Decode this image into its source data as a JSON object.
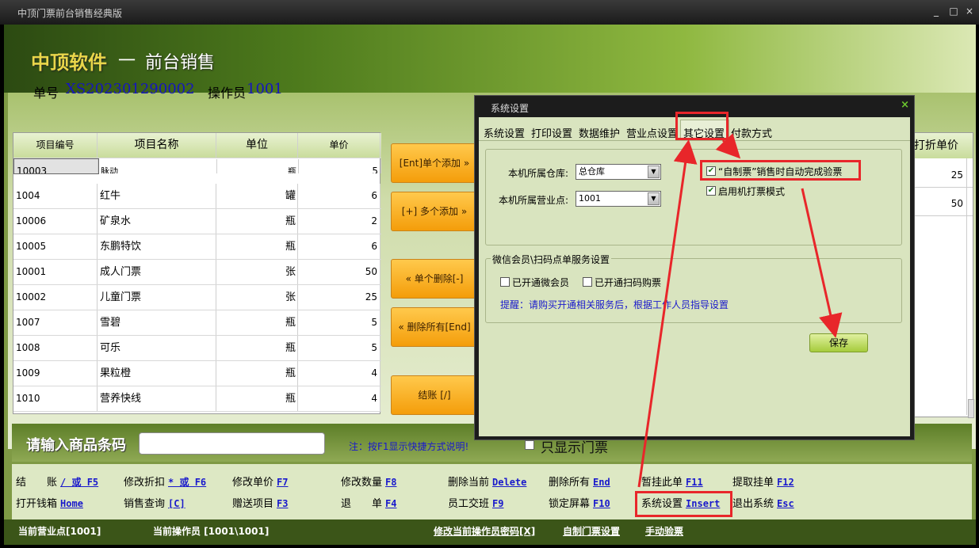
{
  "window": {
    "title": "中顶门票前台销售经典版",
    "min": "_",
    "max": "□",
    "close": "×"
  },
  "banner": {
    "brand": "中顶软件",
    "dash": "一",
    "module": "前台销售"
  },
  "order": {
    "number_label": "单号",
    "number": "XS202301290002",
    "operator_label": "操作员",
    "operator": "1001"
  },
  "table": {
    "headers": [
      "项目编号",
      "项目名称",
      "单位",
      "单价"
    ],
    "rows": [
      [
        "10003",
        "脉动",
        "瓶",
        "5"
      ],
      [
        "1004",
        "红牛",
        "罐",
        "6"
      ],
      [
        "10006",
        "矿泉水",
        "瓶",
        "2"
      ],
      [
        "10005",
        "东鹏特饮",
        "瓶",
        "6"
      ],
      [
        "10001",
        "成人门票",
        "张",
        "50"
      ],
      [
        "10002",
        "儿童门票",
        "张",
        "25"
      ],
      [
        "1007",
        "雪碧",
        "瓶",
        "5"
      ],
      [
        "1008",
        "可乐",
        "瓶",
        "5"
      ],
      [
        "1009",
        "果粒橙",
        "瓶",
        "4"
      ],
      [
        "1010",
        "营养快线",
        "瓶",
        "4"
      ]
    ]
  },
  "actions": {
    "add_single": "[Ent]单个添加 »",
    "add_multi": "[+] 多个添加 »",
    "del_single": "« 单个删除[-]",
    "del_all": "« 删除所有[End]",
    "checkout": "结账 [/]"
  },
  "right_table": {
    "header": "打折单价",
    "values": [
      "25",
      "50"
    ]
  },
  "barcode": {
    "label": "请输入商品条码",
    "value": "",
    "note": "注：按F1显示快捷方式说明!",
    "only_tickets": "只显示门票"
  },
  "shortcuts": {
    "row1": [
      {
        "label": "结　　账",
        "key": "/ 或 F5"
      },
      {
        "label": "修改折扣",
        "key": "* 或 F6"
      },
      {
        "label": "修改单价",
        "key": "F7"
      },
      {
        "label": "修改数量",
        "key": "F8"
      },
      {
        "label": "删除当前",
        "key": "Delete"
      },
      {
        "label": "删除所有",
        "key": "End"
      },
      {
        "label": "暂挂此单",
        "key": "F11"
      },
      {
        "label": "提取挂单",
        "key": "F12"
      }
    ],
    "row2": [
      {
        "label": "打开钱箱",
        "key": "Home"
      },
      {
        "label": "销售查询",
        "key": "[C]"
      },
      {
        "label": "赠送项目",
        "key": "F3"
      },
      {
        "label": "退　　单",
        "key": "F4"
      },
      {
        "label": "员工交班",
        "key": "F9"
      },
      {
        "label": "锁定屏幕",
        "key": "F10"
      },
      {
        "label": "系统设置",
        "key": "Insert"
      },
      {
        "label": "退出系统",
        "key": "Esc"
      }
    ]
  },
  "status": {
    "point": "当前营业点[1001]",
    "operator": "当前操作员 [1001\\1001]",
    "change_pwd": "修改当前操作员密码[X]",
    "custom_ticket": "自制门票设置",
    "manual_check": "手动验票"
  },
  "dialog": {
    "title": "系统设置",
    "close": "×",
    "tabs": [
      "系统设置",
      "打印设置",
      "数据维护",
      "营业点设置",
      "其它设置",
      "付款方式"
    ],
    "warehouse_label": "本机所属仓库:",
    "warehouse_value": "总仓库",
    "point_label": "本机所属营业点:",
    "point_value": "1001",
    "opt_auto_check": "“自制票”销售时自动完成验票",
    "opt_auto_check_checked": true,
    "opt_ticket_print": "启用机打票模式",
    "opt_ticket_print_checked": true,
    "wechat_group": "微信会员\\扫码点单服务设置",
    "opt_wechat_member": "已开通微会员",
    "opt_scan_buy": "已开通扫码购票",
    "tip": "提醒：请购买开通相关服务后，根据工作人员指导设置",
    "save": "保存"
  },
  "colors": {
    "link_blue": "#1919cc",
    "annotation_red": "#e8262a",
    "theme_green": "#7f9a45",
    "button_orange": "#f7a315"
  }
}
